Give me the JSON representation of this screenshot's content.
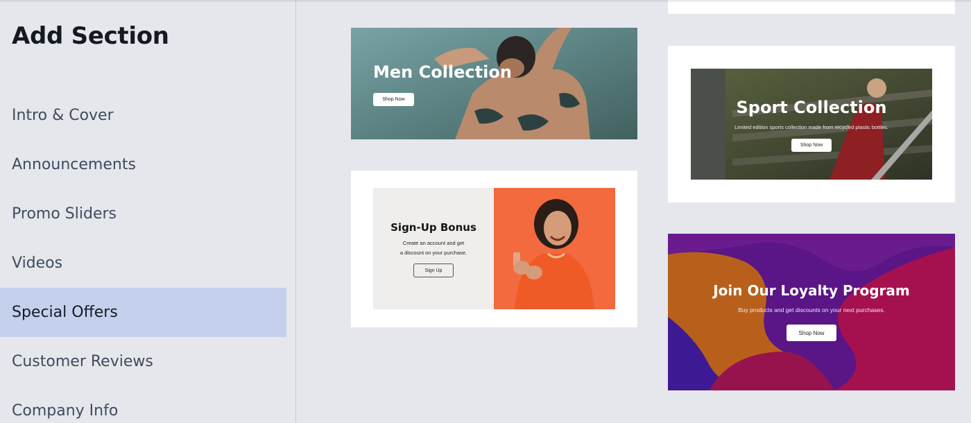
{
  "sidebar": {
    "title": "Add Section",
    "items": [
      {
        "label": "Intro & Cover",
        "active": false
      },
      {
        "label": "Announcements",
        "active": false
      },
      {
        "label": "Promo Sliders",
        "active": false
      },
      {
        "label": "Videos",
        "active": false
      },
      {
        "label": "Special Offers",
        "active": true
      },
      {
        "label": "Customer Reviews",
        "active": false
      },
      {
        "label": "Company Info",
        "active": false
      }
    ]
  },
  "cards": {
    "men": {
      "title": "Men Collection",
      "button": "Shop Now"
    },
    "sport": {
      "title": "Sport Collection",
      "subtitle": "Limited edition sports collection made from recycled plastic bottles.",
      "button": "Shop Now"
    },
    "signup": {
      "title": "Sign-Up Bonus",
      "line1": "Create an account and get",
      "line2": "a discount on your purchase.",
      "button": "Sign Up"
    },
    "loyalty": {
      "title": "Join Our Loyalty Program",
      "subtitle": "Buy products and get discounts on your next purchases.",
      "button": "Shop Now"
    }
  },
  "colors": {
    "active_nav_bg": "#c5d0ed",
    "background": "#e5e7ec",
    "signup_accent": "#f36a3f",
    "loyalty_purple": "#5a1586",
    "loyalty_orange": "#c0661c",
    "loyalty_magenta": "#a5104e"
  }
}
